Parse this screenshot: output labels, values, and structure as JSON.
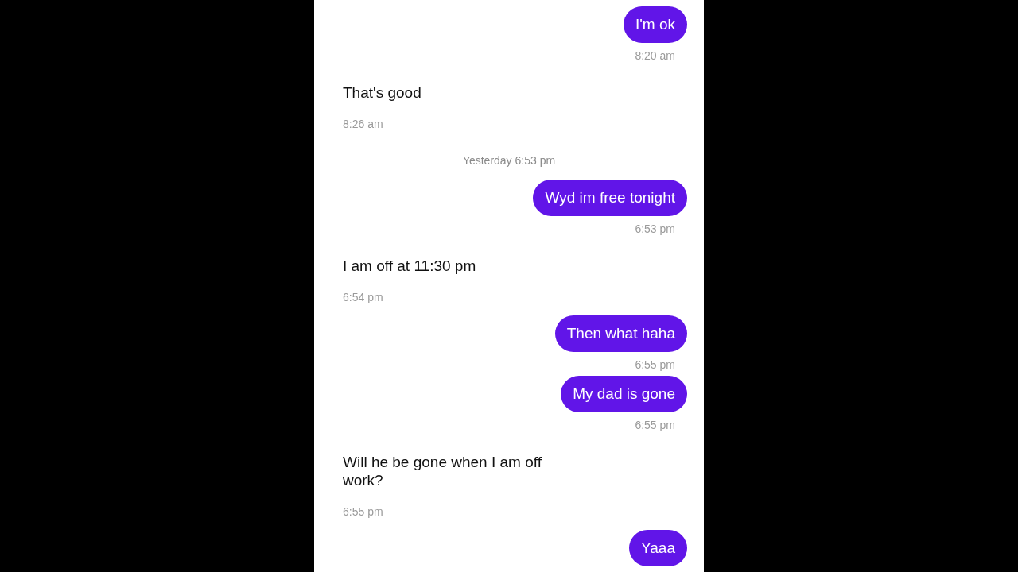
{
  "messages": [
    {
      "kind": "sent",
      "text": "I'm ok",
      "time": "8:20 am"
    },
    {
      "kind": "received",
      "text": "That's good",
      "time": "8:26 am"
    },
    {
      "kind": "date",
      "text": "Yesterday 6:53 pm"
    },
    {
      "kind": "sent",
      "text": "Wyd im free tonight",
      "time": "6:53 pm"
    },
    {
      "kind": "received",
      "text": "I am off at 11:30 pm",
      "time": "6:54 pm"
    },
    {
      "kind": "sent",
      "text": "Then what haha",
      "time": "6:55 pm"
    },
    {
      "kind": "sent",
      "text": "My dad is gone",
      "time": "6:55 pm"
    },
    {
      "kind": "received",
      "text": "Will he be gone when I am off work?",
      "time": "6:55 pm"
    },
    {
      "kind": "sent",
      "text": "Yaaa"
    }
  ]
}
